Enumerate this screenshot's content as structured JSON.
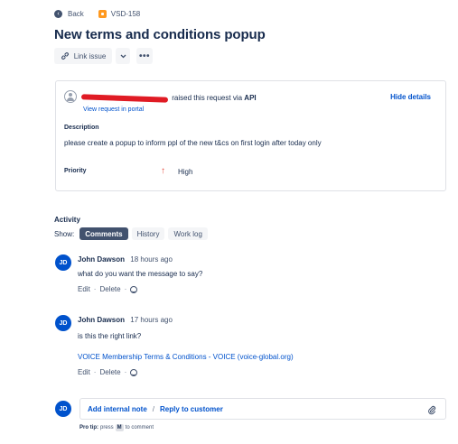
{
  "nav": {
    "back_label": "Back",
    "issue_key": "VSD-158"
  },
  "issue": {
    "title": "New terms and conditions popup"
  },
  "toolbar": {
    "link_issue_label": "Link issue",
    "more_label": "•••"
  },
  "request": {
    "raised_text": "raised this request via",
    "channel": "API",
    "view_portal_label": "View request in portal",
    "hide_details_label": "Hide details",
    "description_label": "Description",
    "description_text": "please create a popup to inform ppl of the new t&cs on first login after today only",
    "priority_label": "Priority",
    "priority_value": "High"
  },
  "activity": {
    "label": "Activity",
    "show_label": "Show:",
    "filters": [
      "Comments",
      "History",
      "Work log"
    ],
    "active_filter": "Comments"
  },
  "comments": [
    {
      "initials": "JD",
      "author": "John Dawson",
      "time": "18 hours ago",
      "body": "what do you want the message to say?",
      "link": "",
      "edit_label": "Edit",
      "delete_label": "Delete"
    },
    {
      "initials": "JD",
      "author": "John Dawson",
      "time": "17 hours ago",
      "body": "is this the right link?",
      "link": "VOICE Membership Terms & Conditions - VOICE (voice-global.org)",
      "edit_label": "Edit",
      "delete_label": "Delete"
    }
  ],
  "reply": {
    "initials": "JD",
    "internal_note_label": "Add internal note",
    "separator": "/",
    "reply_customer_label": "Reply to customer",
    "pro_tip_label": "Pro tip:",
    "pro_tip_press": "press",
    "pro_tip_key": "M",
    "pro_tip_suffix": "to comment"
  },
  "colors": {
    "accent": "#0052cc",
    "priority_high": "#e5493a",
    "issue_type": "#ff991f",
    "active_filter_bg": "#42526e"
  }
}
